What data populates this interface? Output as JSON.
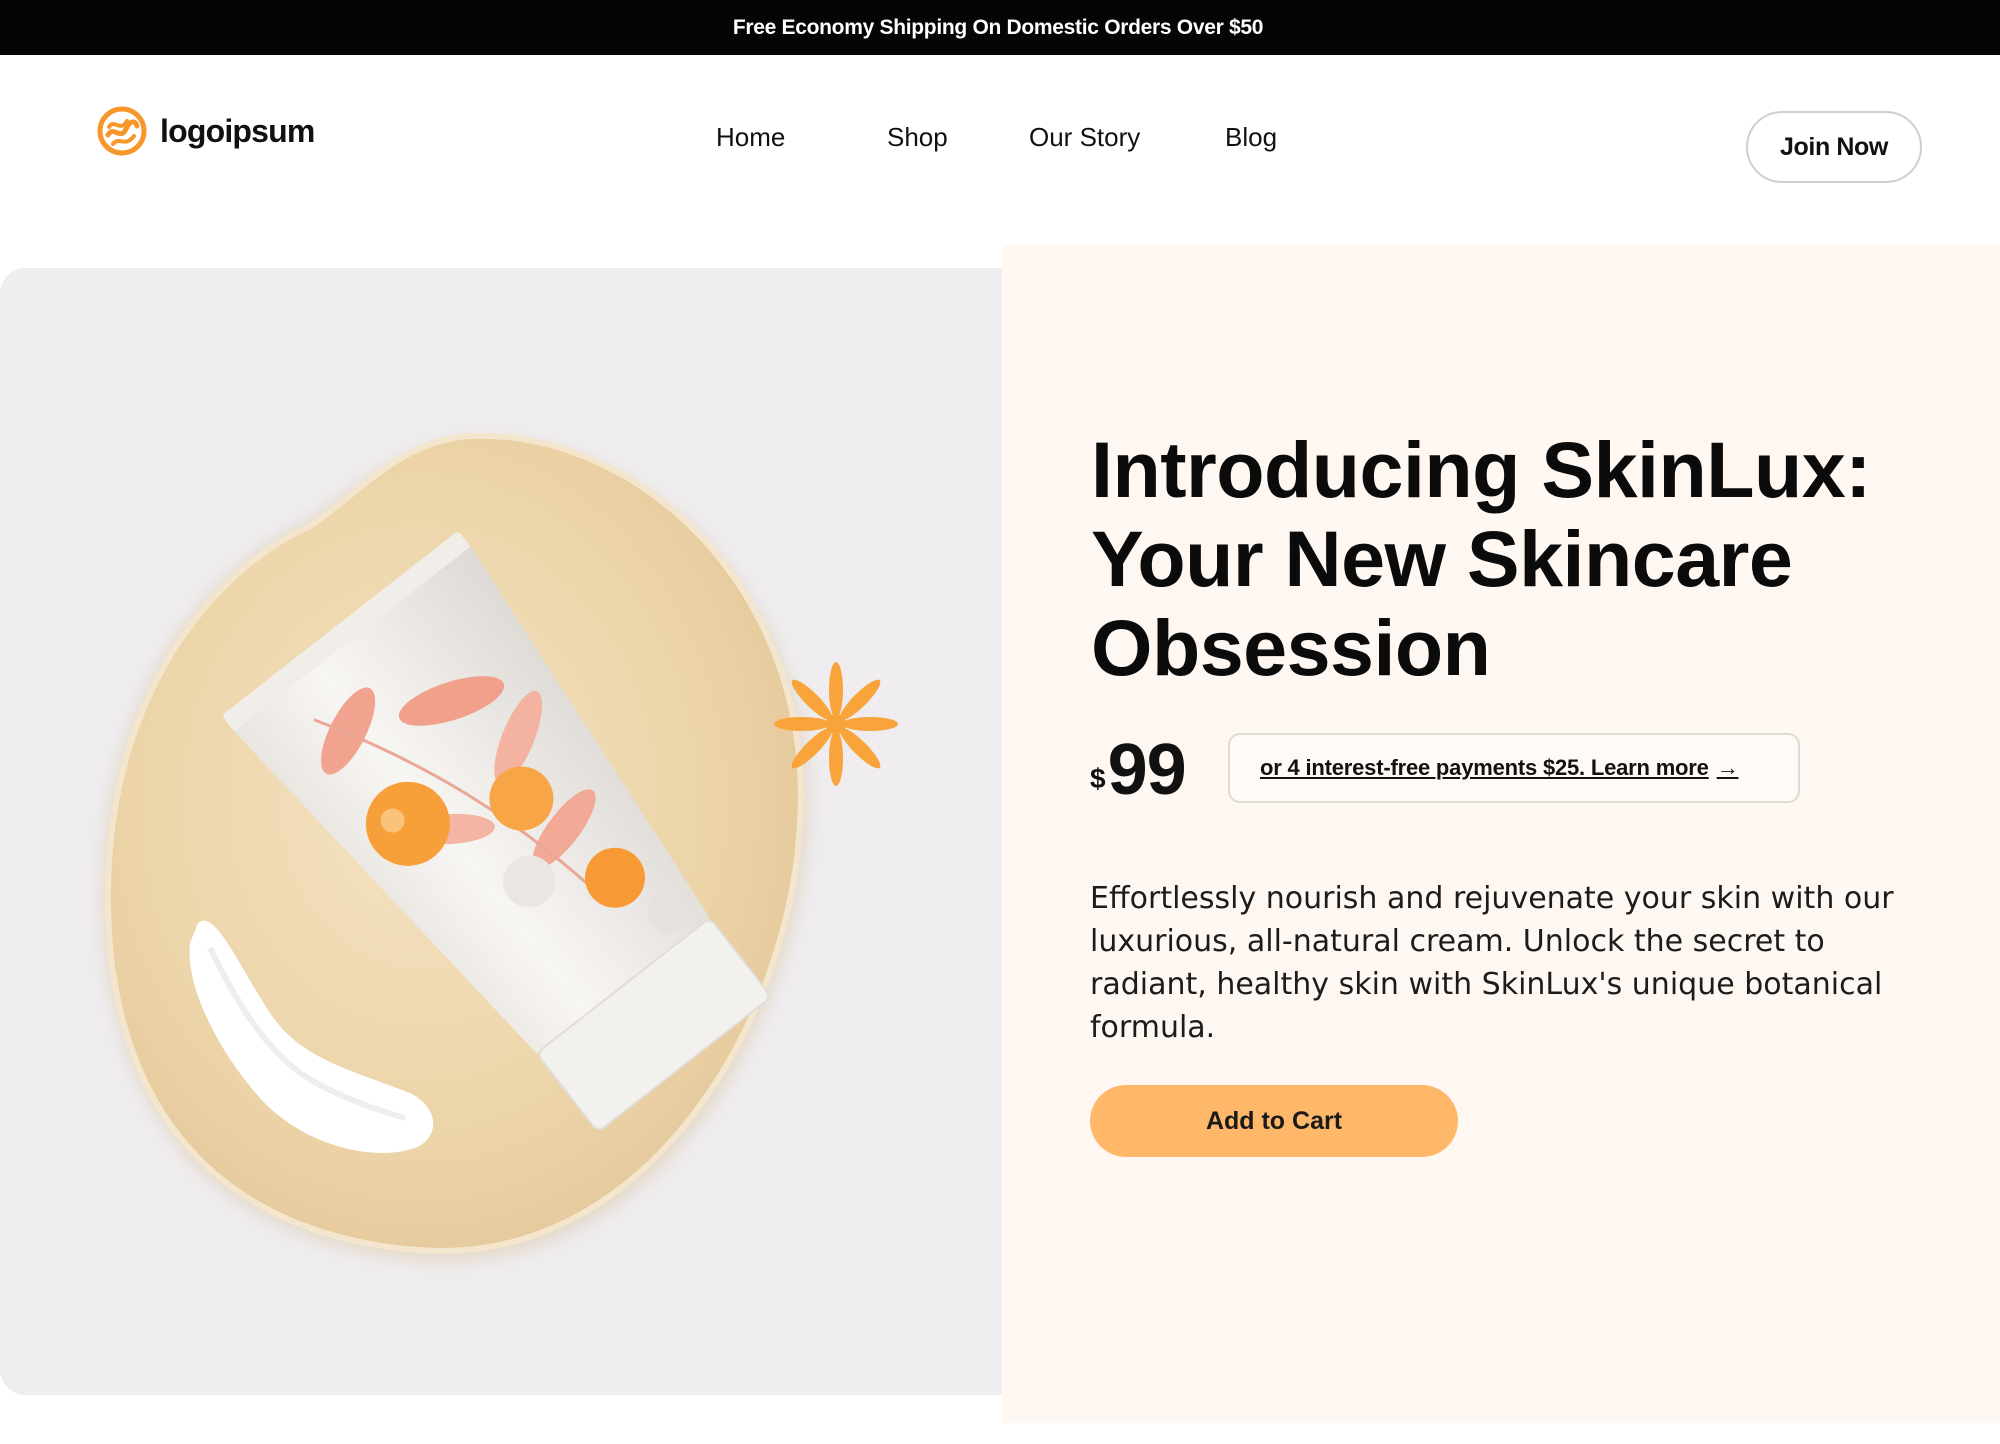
{
  "announcement": {
    "text": "Free Economy Shipping On Domestic Orders Over $50"
  },
  "brand": {
    "name": "logoipsum",
    "icon": "logo-mark-icon",
    "accent": "#f7962b"
  },
  "nav": {
    "links": [
      {
        "label": "Home"
      },
      {
        "label": "Shop"
      },
      {
        "label": "Our Story"
      },
      {
        "label": "Blog"
      }
    ],
    "join_label": "Join Now"
  },
  "hero": {
    "image_icons": [
      "skincare-tube",
      "asterisk-decoration",
      "cream-swatch",
      "round-plate"
    ],
    "headline": "Introducing SkinLux: Your New Skincare Obsession",
    "price": {
      "currency": "$",
      "amount": "99"
    },
    "installments": {
      "text": "or 4 interest-free payments $25. Learn more",
      "arrow": "→"
    },
    "description": "Effortlessly nourish and rejuvenate your skin with our luxurious, all-natural cream. Unlock the secret to radiant, healthy skin with SkinLux's unique botanical formula.",
    "cta_label": "Add to Cart"
  },
  "colors": {
    "announcement_bg": "#050505",
    "panel_bg": "#fff8f2",
    "image_bg": "#efedf0",
    "cta_bg": "#ffb76a",
    "accent_orange": "#f7962b"
  }
}
